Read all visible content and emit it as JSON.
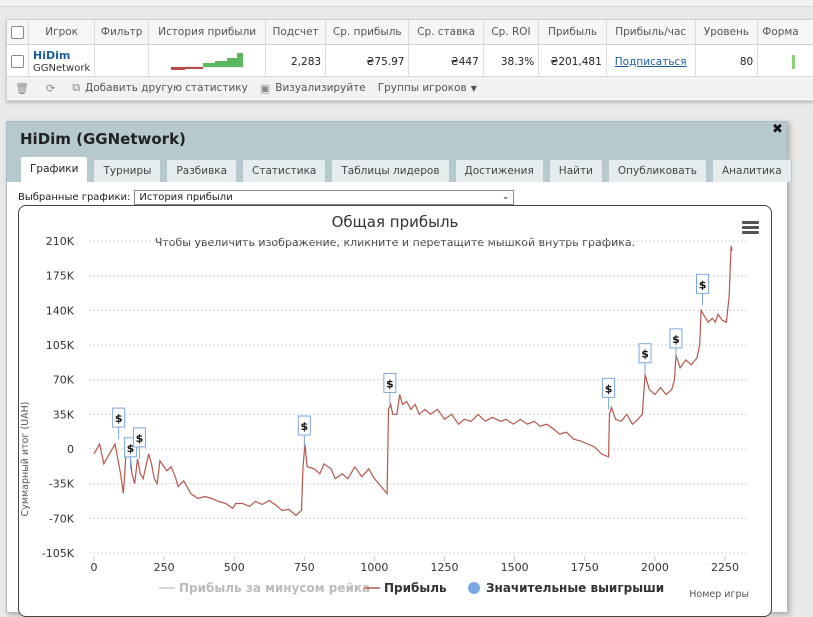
{
  "stats_table": {
    "headers": [
      "Игрок",
      "Фильтр",
      "История прибыли",
      "Подсчет",
      "Ср. прибыль",
      "Ср. ставка",
      "Ср. ROI",
      "Прибыль",
      "Прибыль/час",
      "Уровень",
      "Форма"
    ],
    "row": {
      "player_name": "HiDim",
      "network": "GGNetwork",
      "filter": "",
      "count": "2,283",
      "avg_profit": "₴75.97",
      "avg_stake": "₴447",
      "avg_roi": "38.3%",
      "profit": "₴201,481",
      "profit_per_hour": "Подписаться",
      "level": "80"
    },
    "toolbar": {
      "add_stats": "Добавить другую статистику",
      "visualize": "Визуализируйте",
      "player_groups": "Группы игроков"
    },
    "colors": {
      "link": "#1b5e9e"
    }
  },
  "player_window": {
    "title": "HiDim (GGNetwork)",
    "tabs": [
      "Графики",
      "Турниры",
      "Разбивка",
      "Статистика",
      "Таблицы лидеров",
      "Достижения",
      "Найти",
      "Опубликовать",
      "Аналитика"
    ],
    "active_tab": "Графики",
    "selector_label": "Выбранные графики:",
    "selector_value": "История прибыли",
    "colors": {
      "header": "#b6c9cf"
    }
  },
  "chart_data": {
    "type": "line",
    "title": "Общая прибыль",
    "subtitle": "Чтобы увеличить изображение, кликните и перетащите мышкой внутрь графика.",
    "xlabel": "Номер игры",
    "ylabel": "Суммарный итог (UAH)",
    "ylim": [
      -105000,
      210000
    ],
    "xlim": [
      0,
      2300
    ],
    "x_ticks": [
      "0",
      "250",
      "500",
      "750",
      "1000",
      "1250",
      "1500",
      "1750",
      "2000",
      "2250"
    ],
    "y_ticks": [
      "210K",
      "175K",
      "140K",
      "105K",
      "70K",
      "35K",
      "0",
      "-35K",
      "-70K",
      "-105K"
    ],
    "grid": "horizontal-dashed",
    "legend": [
      "Прибыль за минусом рейка",
      "Прибыль",
      "Значительные выигрыши"
    ],
    "legend_position": "bottom",
    "colors": {
      "profit": "#b5564e",
      "no_rake": "#cccccc",
      "big_win": "#7aa7e0"
    },
    "series": [
      {
        "name": "Прибыль",
        "points": [
          [
            0,
            -5000
          ],
          [
            20,
            5000
          ],
          [
            35,
            -15000
          ],
          [
            55,
            -5000
          ],
          [
            75,
            5000
          ],
          [
            95,
            -25000
          ],
          [
            105,
            -45000
          ],
          [
            115,
            0
          ],
          [
            125,
            5000
          ],
          [
            135,
            -25000
          ],
          [
            145,
            -35000
          ],
          [
            155,
            -10000
          ],
          [
            165,
            -25000
          ],
          [
            175,
            -30000
          ],
          [
            195,
            -5000
          ],
          [
            205,
            -15000
          ],
          [
            215,
            -30000
          ],
          [
            225,
            -35000
          ],
          [
            235,
            -12000
          ],
          [
            260,
            -22000
          ],
          [
            275,
            -18000
          ],
          [
            290,
            -28000
          ],
          [
            300,
            -38000
          ],
          [
            320,
            -32000
          ],
          [
            345,
            -45000
          ],
          [
            370,
            -50000
          ],
          [
            395,
            -48000
          ],
          [
            420,
            -50000
          ],
          [
            445,
            -53000
          ],
          [
            470,
            -55000
          ],
          [
            495,
            -60000
          ],
          [
            505,
            -55000
          ],
          [
            530,
            -55000
          ],
          [
            555,
            -58000
          ],
          [
            575,
            -53000
          ],
          [
            600,
            -56000
          ],
          [
            625,
            -52000
          ],
          [
            650,
            -57000
          ],
          [
            670,
            -62000
          ],
          [
            695,
            -61000
          ],
          [
            720,
            -67000
          ],
          [
            740,
            -62000
          ],
          [
            745,
            -20000
          ],
          [
            752,
            5000
          ],
          [
            760,
            -18000
          ],
          [
            785,
            -20000
          ],
          [
            805,
            -25000
          ],
          [
            820,
            -15000
          ],
          [
            845,
            -20000
          ],
          [
            860,
            -30000
          ],
          [
            885,
            -25000
          ],
          [
            905,
            -30000
          ],
          [
            930,
            -18000
          ],
          [
            955,
            -28000
          ],
          [
            980,
            -20000
          ],
          [
            1000,
            -30000
          ],
          [
            1045,
            -45000
          ],
          [
            1050,
            40000
          ],
          [
            1058,
            45000
          ],
          [
            1065,
            35000
          ],
          [
            1080,
            35000
          ],
          [
            1090,
            55000
          ],
          [
            1100,
            45000
          ],
          [
            1115,
            48000
          ],
          [
            1130,
            40000
          ],
          [
            1145,
            45000
          ],
          [
            1160,
            35000
          ],
          [
            1180,
            40000
          ],
          [
            1200,
            35000
          ],
          [
            1225,
            40000
          ],
          [
            1250,
            30000
          ],
          [
            1275,
            35000
          ],
          [
            1300,
            25000
          ],
          [
            1320,
            30000
          ],
          [
            1345,
            28000
          ],
          [
            1370,
            35000
          ],
          [
            1395,
            28000
          ],
          [
            1420,
            32000
          ],
          [
            1450,
            28000
          ],
          [
            1470,
            30000
          ],
          [
            1495,
            25000
          ],
          [
            1520,
            30000
          ],
          [
            1545,
            25000
          ],
          [
            1570,
            28000
          ],
          [
            1590,
            23000
          ],
          [
            1615,
            25000
          ],
          [
            1640,
            20000
          ],
          [
            1660,
            15000
          ],
          [
            1685,
            17000
          ],
          [
            1710,
            10000
          ],
          [
            1735,
            8000
          ],
          [
            1760,
            5000
          ],
          [
            1785,
            2000
          ],
          [
            1810,
            -5000
          ],
          [
            1835,
            -8000
          ],
          [
            1838,
            35000
          ],
          [
            1845,
            42000
          ],
          [
            1860,
            30000
          ],
          [
            1880,
            28000
          ],
          [
            1900,
            35000
          ],
          [
            1920,
            25000
          ],
          [
            1940,
            30000
          ],
          [
            1955,
            35000
          ],
          [
            1965,
            75000
          ],
          [
            1980,
            60000
          ],
          [
            2000,
            55000
          ],
          [
            2020,
            62000
          ],
          [
            2040,
            55000
          ],
          [
            2060,
            60000
          ],
          [
            2070,
            70000
          ],
          [
            2075,
            95000
          ],
          [
            2090,
            82000
          ],
          [
            2110,
            90000
          ],
          [
            2130,
            85000
          ],
          [
            2150,
            92000
          ],
          [
            2160,
            105000
          ],
          [
            2165,
            140000
          ],
          [
            2175,
            135000
          ],
          [
            2190,
            128000
          ],
          [
            2205,
            132000
          ],
          [
            2215,
            128000
          ],
          [
            2225,
            136000
          ],
          [
            2240,
            130000
          ],
          [
            2255,
            128000
          ],
          [
            2265,
            155000
          ],
          [
            2272,
            205000
          ],
          [
            2275,
            200000
          ]
        ]
      }
    ],
    "big_wins": [
      [
        88,
        10000
      ],
      [
        130,
        -20000
      ],
      [
        162,
        -10000
      ],
      [
        750,
        2000
      ],
      [
        1055,
        45000
      ],
      [
        1835,
        40000
      ],
      [
        1965,
        75000
      ],
      [
        2075,
        90000
      ],
      [
        2170,
        145000
      ]
    ]
  }
}
